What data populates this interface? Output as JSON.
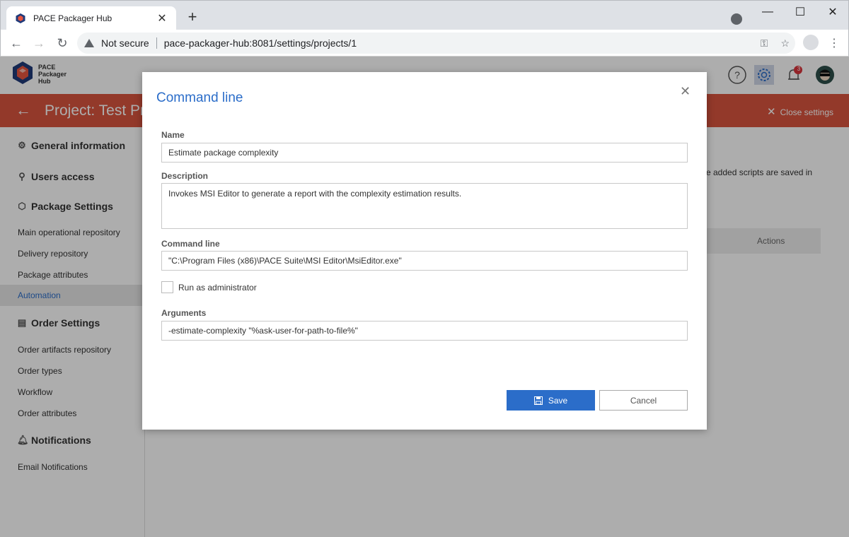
{
  "browser": {
    "tab_title": "PACE Packager Hub",
    "url_security": "Not secure",
    "url_host": "pace-packager-hub",
    "url_rest": ":8081/settings/projects/1"
  },
  "app": {
    "logo_text_1": "PACE",
    "logo_text_2": "Packager",
    "logo_text_3": "Hub",
    "notification_count": "3"
  },
  "banner": {
    "title": "Project: Test Pr",
    "close_label": "Close settings"
  },
  "sidebar": {
    "general": "General information",
    "users": "Users access",
    "package_settings": "Package Settings",
    "package_items": [
      "Main operational repository",
      "Delivery repository",
      "Package attributes",
      "Automation"
    ],
    "order_settings": "Order Settings",
    "order_items": [
      "Order artifacts repository",
      "Order types",
      "Workflow",
      "Order attributes"
    ],
    "notifications": "Notifications",
    "notification_items": [
      "Email Notifications"
    ]
  },
  "background": {
    "text": "e added scripts are saved in",
    "table_header": "Actions"
  },
  "dialog": {
    "title": "Command line",
    "name_label": "Name",
    "name_value": "Estimate package complexity",
    "description_label": "Description",
    "description_value": "Invokes MSI Editor to generate a report with the complexity estimation results.",
    "command_label": "Command line",
    "command_value": "\"C:\\Program Files (x86)\\PACE Suite\\MSI Editor\\MsiEditor.exe\"",
    "run_as_admin_label": "Run as administrator",
    "arguments_label": "Arguments",
    "arguments_value": "-estimate-complexity \"%ask-user-for-path-to-file%\"",
    "save_label": "Save",
    "cancel_label": "Cancel"
  }
}
